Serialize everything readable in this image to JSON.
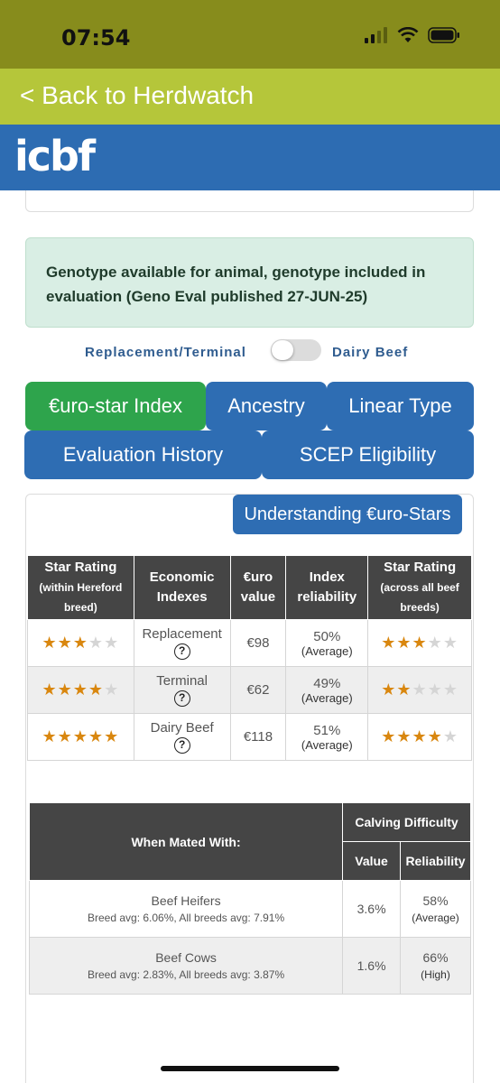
{
  "status_bar": {
    "time": "07:54",
    "icons": [
      "signal-icon",
      "wifi-icon",
      "battery-icon"
    ]
  },
  "nav": {
    "back_label": "< Back to Herdwatch"
  },
  "brand": {
    "logo_text": "icbf"
  },
  "alert": {
    "message": "Genotype available for animal, genotype included in evaluation (Geno Eval published 27-JUN-25)"
  },
  "toggle": {
    "left_label": "Replacement/Terminal",
    "right_label": "Dairy Beef",
    "state": "off"
  },
  "tabs": [
    {
      "label": "€uro-star Index",
      "active": true
    },
    {
      "label": "Ancestry",
      "active": false
    },
    {
      "label": "Linear Type",
      "active": false
    },
    {
      "label": "Evaluation History",
      "active": false
    },
    {
      "label": "SCEP Eligibility",
      "active": false
    }
  ],
  "understanding_button": "Understanding €uro-Stars",
  "index_table": {
    "headers": {
      "star_within": "Star Rating",
      "star_within_sub": "(within Hereford breed)",
      "economic": "Economic Indexes",
      "euro_value": "€uro value",
      "reliability": "Index reliability",
      "star_across": "Star Rating",
      "star_across_sub": "(across all beef breeds)"
    },
    "rows": [
      {
        "index": "Replacement",
        "help": "?",
        "value": "€98",
        "reliability": "50%",
        "reliability_level": "(Average)",
        "stars_within": 3,
        "stars_across": 3
      },
      {
        "index": "Terminal",
        "help": "?",
        "value": "€62",
        "reliability": "49%",
        "reliability_level": "(Average)",
        "stars_within": 4,
        "stars_across": 2
      },
      {
        "index": "Dairy Beef",
        "help": "?",
        "value": "€118",
        "reliability": "51%",
        "reliability_level": "(Average)",
        "stars_within": 5,
        "stars_across": 4
      }
    ],
    "max_stars": 5
  },
  "calving_table": {
    "mated_header": "When Mated With:",
    "group_header": "Calving Difficulty",
    "value_header": "Value",
    "reliability_header": "Reliability",
    "rows": [
      {
        "name": "Beef Heifers",
        "avg": "Breed avg: 6.06%, All breeds avg: 7.91%",
        "value": "3.6%",
        "reliability": "58%",
        "reliability_level": "(Average)"
      },
      {
        "name": "Beef Cows",
        "avg": "Breed avg: 2.83%, All breeds avg: 3.87%",
        "value": "1.6%",
        "reliability": "66%",
        "reliability_level": "(High)"
      }
    ]
  }
}
